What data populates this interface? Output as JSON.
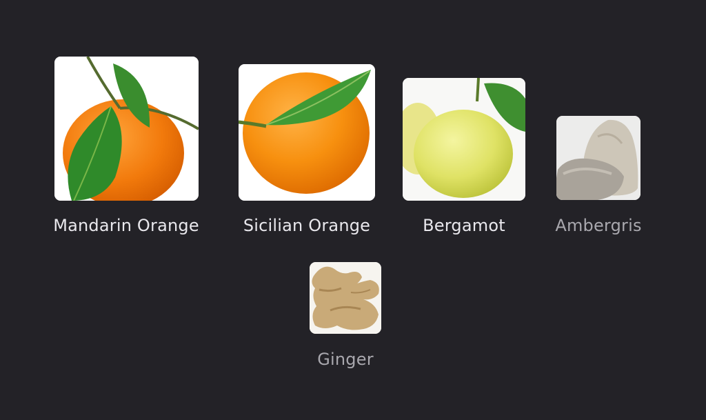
{
  "notes": [
    {
      "name": "Mandarin Orange",
      "image": "mandarin-orange-image",
      "emphasis": "primary"
    },
    {
      "name": "Sicilian Orange",
      "image": "sicilian-orange-image",
      "emphasis": "primary"
    },
    {
      "name": "Bergamot",
      "image": "bergamot-image",
      "emphasis": "primary"
    },
    {
      "name": "Ambergris",
      "image": "ambergris-image",
      "emphasis": "secondary"
    },
    {
      "name": "Ginger",
      "image": "ginger-image",
      "emphasis": "secondary"
    }
  ],
  "colors": {
    "background": "#232227",
    "label_primary": "#e9e8ed",
    "label_secondary": "#a9a8ae"
  }
}
